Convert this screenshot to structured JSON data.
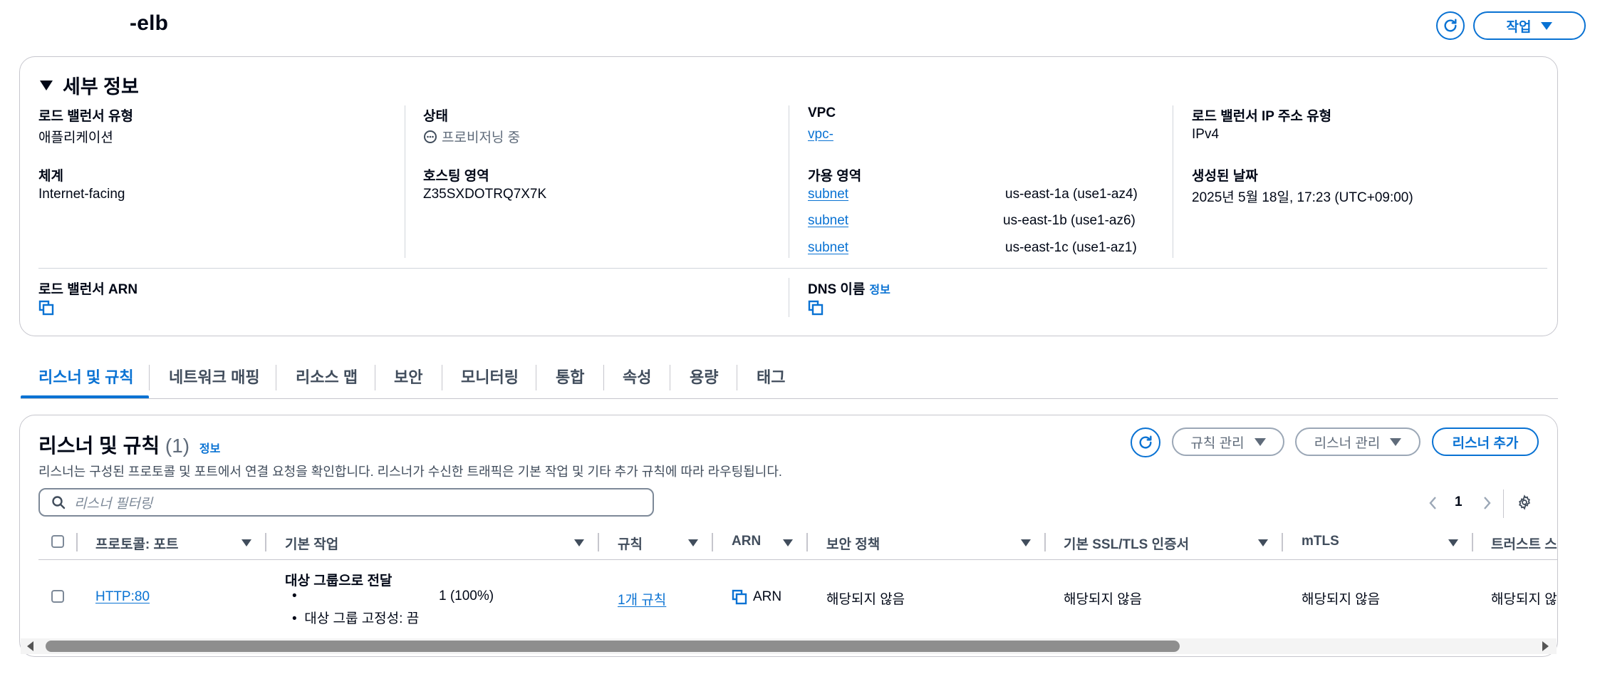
{
  "header": {
    "title_suffix": "-elb",
    "refresh_icon": "refresh-icon",
    "actions_label": "작업"
  },
  "details": {
    "section_title": "세부 정보",
    "lb_type_key": "로드 밸런서 유형",
    "lb_type_value": "애플리케이션",
    "scheme_key": "체계",
    "scheme_value": "Internet-facing",
    "status_key": "상태",
    "status_value": "프로비저닝 중",
    "hosted_zone_key": "호스팅 영역",
    "hosted_zone_value": "Z35SXDOTRQ7X7K",
    "vpc_key": "VPC",
    "vpc_value": "vpc-",
    "az_key": "가용 영역",
    "availability_zones": [
      {
        "subnet": "subnet",
        "zone": "us-east-1a (use1-az4)"
      },
      {
        "subnet": "subnet",
        "zone": "us-east-1b (use1-az6)"
      },
      {
        "subnet": "subnet",
        "zone": "us-east-1c (use1-az1)"
      }
    ],
    "ip_type_key": "로드 밸런서 IP 주소 유형",
    "ip_type_value": "IPv4",
    "created_key": "생성된 날짜",
    "created_value": "2025년 5월 18일, 17:23 (UTC+09:00)",
    "arn_key": "로드 밸런서 ARN",
    "dns_key": "DNS 이름",
    "dns_info": "정보"
  },
  "tabs": [
    {
      "label": "리스너 및 규칙",
      "active": true
    },
    {
      "label": "네트워크 매핑"
    },
    {
      "label": "리소스 맵"
    },
    {
      "label": "보안"
    },
    {
      "label": "모니터링"
    },
    {
      "label": "통합"
    },
    {
      "label": "속성"
    },
    {
      "label": "용량"
    },
    {
      "label": "태그"
    }
  ],
  "listeners": {
    "title": "리스너 및 규칙",
    "count": "(1)",
    "info": "정보",
    "description": "리스너는 구성된 프로토콜 및 포트에서 연결 요청을 확인합니다. 리스너가 수신한 트래픽은 기본 작업 및 기타 추가 규칙에 따라 라우팅됩니다.",
    "manage_rules": "규칙 관리",
    "manage_listeners": "리스너 관리",
    "add_listener": "리스너 추가",
    "filter_placeholder": "리스너 필터링",
    "page": "1",
    "columns": [
      "프로토콜: 포트",
      "기본 작업",
      "규칙",
      "ARN",
      "보안 정책",
      "기본 SSL/TLS 인증서",
      "mTLS",
      "트러스트 스"
    ],
    "row": {
      "protocol": "HTTP:80",
      "action_title": "대상 그룹으로 전달",
      "action_bullet1": "",
      "action_weight": "1 (100%)",
      "action_bullet2": "대상 그룹 고정성: 끔",
      "rules": "1개 규칙",
      "arn": "ARN",
      "security_policy": "해당되지 않음",
      "ssl_cert": "해당되지 않음",
      "mtls": "해당되지 않음",
      "trust_store": "해당되지 않"
    }
  },
  "colors": {
    "accent": "#0972d3",
    "text": "#000716",
    "border": "#c6c6cd"
  }
}
